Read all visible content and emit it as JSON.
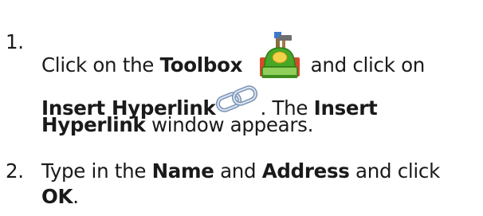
{
  "steps": [
    {
      "number": "1.",
      "line1": {
        "t1": "Click on the ",
        "b1": "Toolbox",
        "t2": "and click on"
      },
      "line2": {
        "b1": "Insert Hyperlink",
        "t1": ". The ",
        "b2": "Insert"
      },
      "line3": {
        "b1": "Hyperlink",
        "t1": " window appears."
      }
    },
    {
      "number": "2.",
      "line1": {
        "t1": "Type in the ",
        "b1": "Name",
        "t2": " and ",
        "b2": "Address",
        "t3": " and click"
      },
      "line2": {
        "b1": "OK",
        "t1": "."
      }
    }
  ],
  "icons": {
    "toolbox": "toolbox-icon",
    "hyperlink": "hyperlink-chain-icon"
  }
}
